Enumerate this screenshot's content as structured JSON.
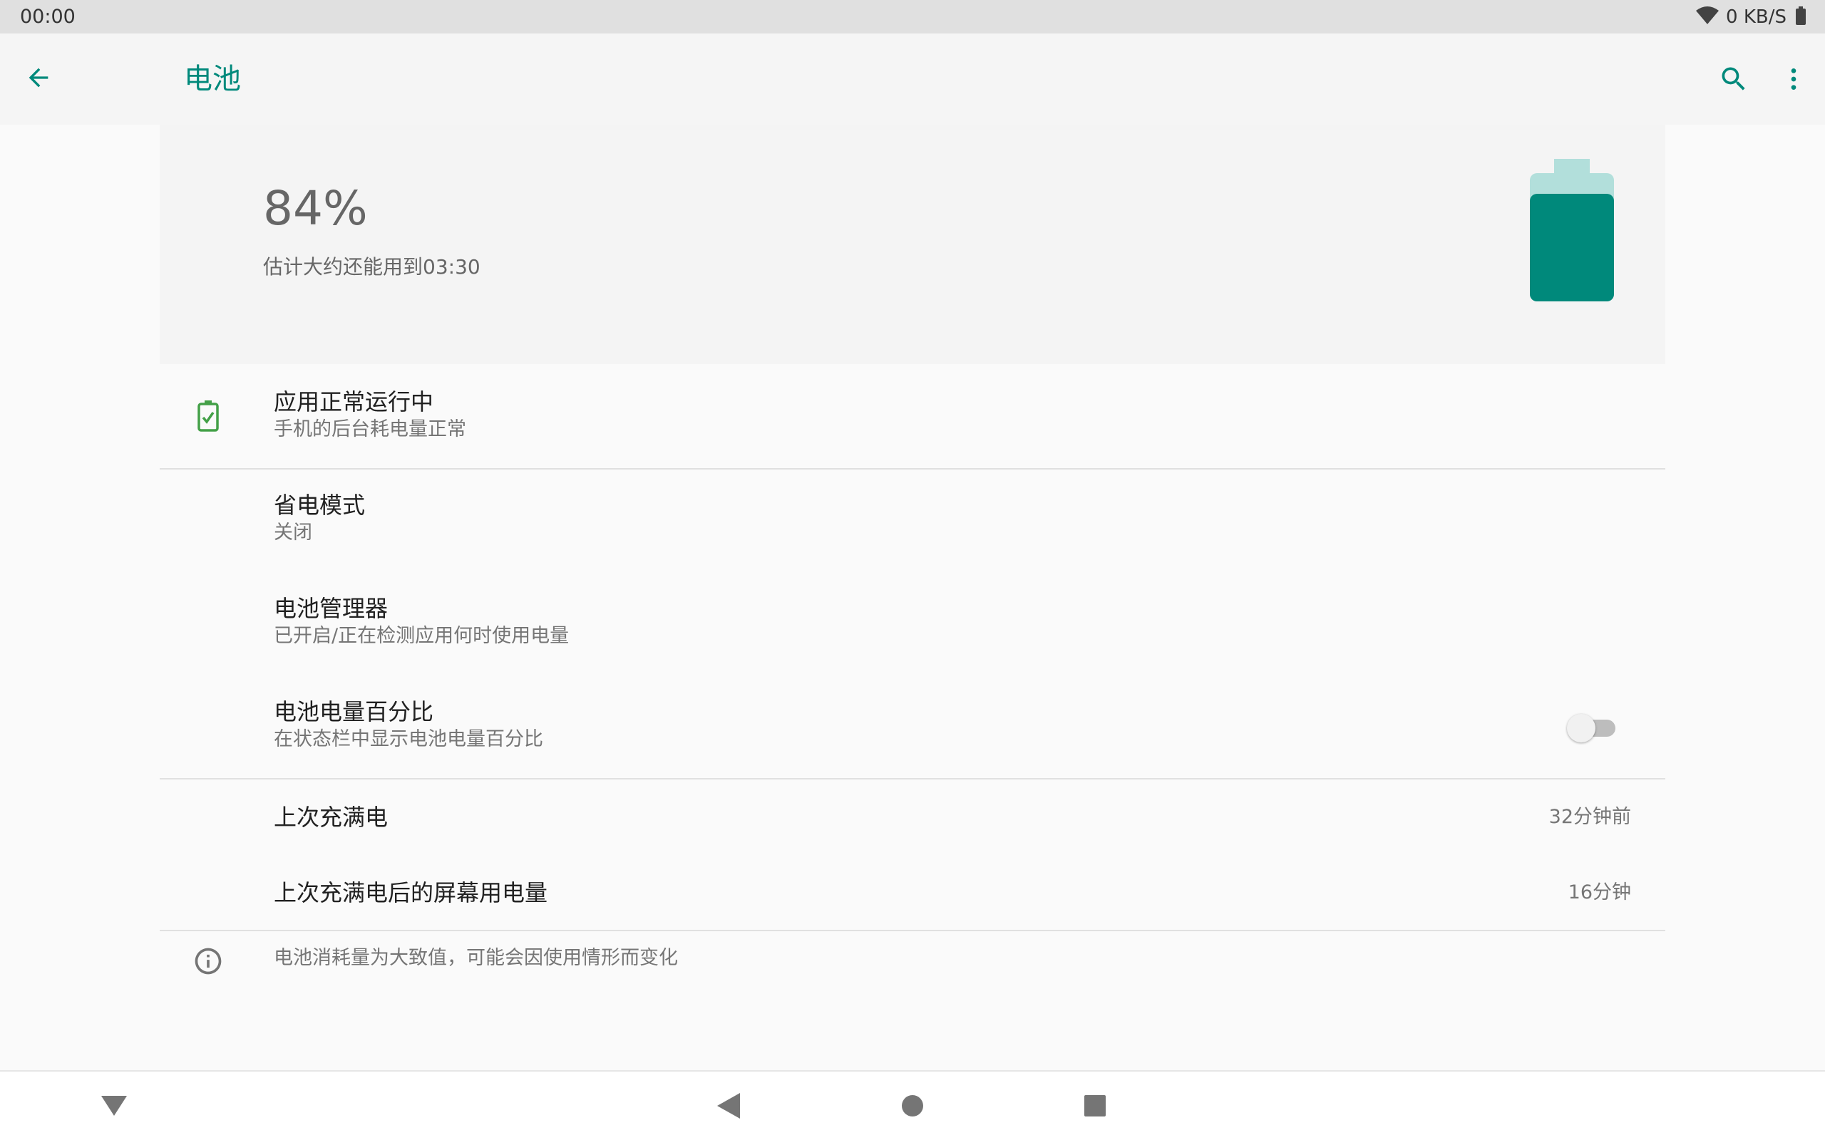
{
  "status_bar": {
    "time": "00:00",
    "net_speed": "0 KB/S"
  },
  "toolbar": {
    "title": "电池",
    "icons": {
      "back": "arrow-left-icon",
      "search": "search-icon",
      "more": "more-vert-icon"
    }
  },
  "battery": {
    "percent": "84%",
    "level": 0.84,
    "estimate": "估计大约还能用到03:30"
  },
  "tips": {
    "title": "应用正常运行中",
    "summary": "手机的后台耗电量正常",
    "icon": "battery-check-icon"
  },
  "settings": {
    "battery_saver": {
      "title": "省电模式",
      "summary": "关闭"
    },
    "battery_manager": {
      "title": "电池管理器",
      "summary": "已开启/正在检测应用何时使用电量"
    },
    "battery_percentage": {
      "title": "电池电量百分比",
      "summary": "在状态栏中显示电池电量百分比",
      "enabled": false
    }
  },
  "usage": {
    "last_full_charge": {
      "title": "上次充满电",
      "value": "32分钟前"
    },
    "screen_usage": {
      "title": "上次充满电后的屏幕用电量",
      "value": "16分钟"
    }
  },
  "footer": {
    "info": "电池消耗量为大致值，可能会因使用情形而变化",
    "icon": "info-icon"
  },
  "colors": {
    "accent": "#00897b",
    "battery_fill": "#00897b",
    "battery_empty": "#b2dfdb",
    "tips_icon": "#43a047"
  }
}
